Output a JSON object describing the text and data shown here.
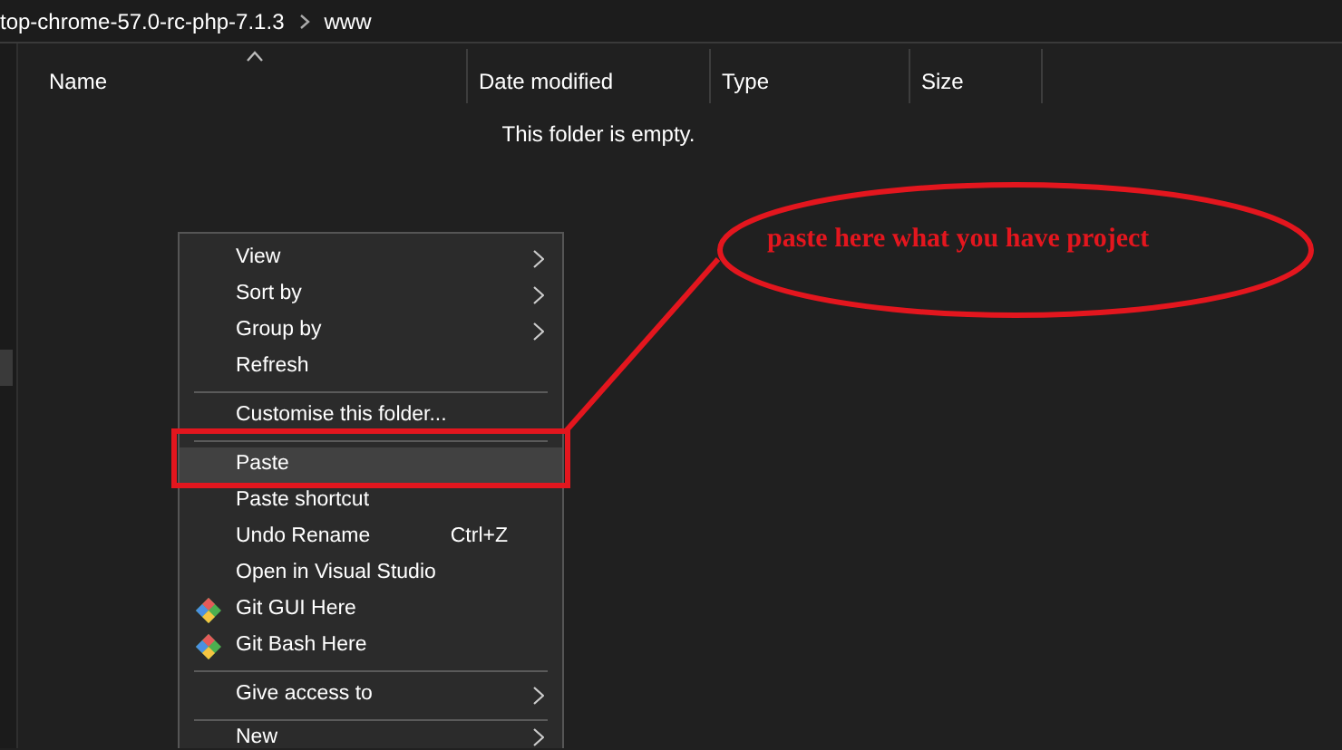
{
  "breadcrumb": [
    {
      "label": "top-chrome-57.0-rc-php-7.1.3"
    },
    {
      "label": "www"
    }
  ],
  "columns": [
    {
      "label": "Name",
      "sorted": true
    },
    {
      "label": "Date modified",
      "sorted": false
    },
    {
      "label": "Type",
      "sorted": false
    },
    {
      "label": "Size",
      "sorted": false
    }
  ],
  "empty_message": "This folder is empty.",
  "context_menu": {
    "items": [
      {
        "kind": "item",
        "label": "View",
        "submenu": true,
        "has_icon": false,
        "selected": false
      },
      {
        "kind": "item",
        "label": "Sort by",
        "submenu": true,
        "has_icon": false,
        "selected": false
      },
      {
        "kind": "item",
        "label": "Group by",
        "submenu": true,
        "has_icon": false,
        "selected": false
      },
      {
        "kind": "item",
        "label": "Refresh",
        "submenu": false,
        "has_icon": false,
        "selected": false
      },
      {
        "kind": "separator"
      },
      {
        "kind": "item",
        "label": "Customise this folder...",
        "submenu": false,
        "has_icon": false,
        "selected": false
      },
      {
        "kind": "separator"
      },
      {
        "kind": "item",
        "label": "Paste",
        "submenu": false,
        "has_icon": false,
        "selected": true
      },
      {
        "kind": "item",
        "label": "Paste shortcut",
        "submenu": false,
        "has_icon": false,
        "selected": false
      },
      {
        "kind": "item",
        "label": "Undo Rename",
        "shortcut": "Ctrl+Z",
        "submenu": false,
        "has_icon": false,
        "selected": false
      },
      {
        "kind": "item",
        "label": "Open in Visual Studio",
        "submenu": false,
        "has_icon": false,
        "selected": false
      },
      {
        "kind": "item",
        "label": "Git GUI Here",
        "submenu": false,
        "has_icon": true,
        "selected": false
      },
      {
        "kind": "item",
        "label": "Git Bash Here",
        "submenu": false,
        "has_icon": true,
        "selected": false
      },
      {
        "kind": "separator"
      },
      {
        "kind": "item",
        "label": "Give access to",
        "submenu": true,
        "has_icon": false,
        "selected": false
      },
      {
        "kind": "separator"
      },
      {
        "kind": "item",
        "label": "New",
        "submenu": true,
        "has_icon": false,
        "selected": false
      }
    ]
  },
  "annotation": {
    "text": "paste here what you have project"
  }
}
